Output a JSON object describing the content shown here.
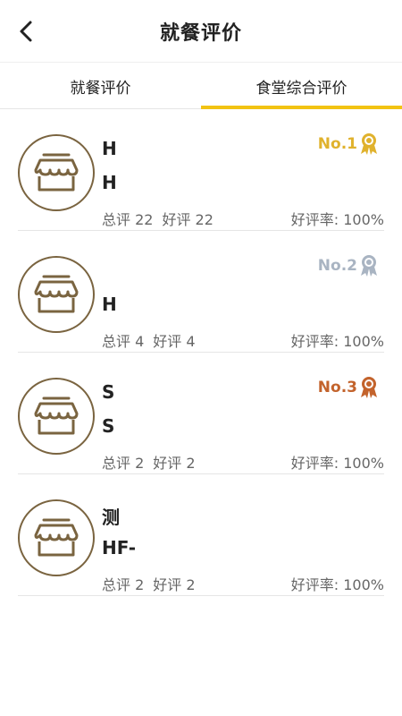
{
  "header": {
    "title": "就餐评价"
  },
  "tabs": [
    {
      "label": "就餐评价",
      "active": false
    },
    {
      "label": "食堂综合评价",
      "active": true
    }
  ],
  "colors": {
    "accent": "#f2c313",
    "avatar_stroke": "#7a6440",
    "gold": "#e0b22d",
    "silver": "#a9b4c2",
    "bronze": "#c3632c"
  },
  "canteens": [
    {
      "name_line1": "H",
      "name_line2": "H",
      "total_label": "总评 22",
      "good_label": "好评 22",
      "rate_label": "好评率: 100%",
      "rank_label": "No.1",
      "medal": "gold-medal-icon"
    },
    {
      "name_line1": "",
      "name_line2": "H",
      "total_label": "总评 4",
      "good_label": "好评 4",
      "rate_label": "好评率: 100%",
      "rank_label": "No.2",
      "medal": "silver-medal-icon"
    },
    {
      "name_line1": "S",
      "name_line2": "S",
      "total_label": "总评 2",
      "good_label": "好评 2",
      "rate_label": "好评率: 100%",
      "rank_label": "No.3",
      "medal": "bronze-medal-icon"
    },
    {
      "name_line1": "测",
      "name_line2": "HF-",
      "total_label": "总评 2",
      "good_label": "好评 2",
      "rate_label": "好评率: 100%",
      "rank_label": "",
      "medal": ""
    }
  ]
}
